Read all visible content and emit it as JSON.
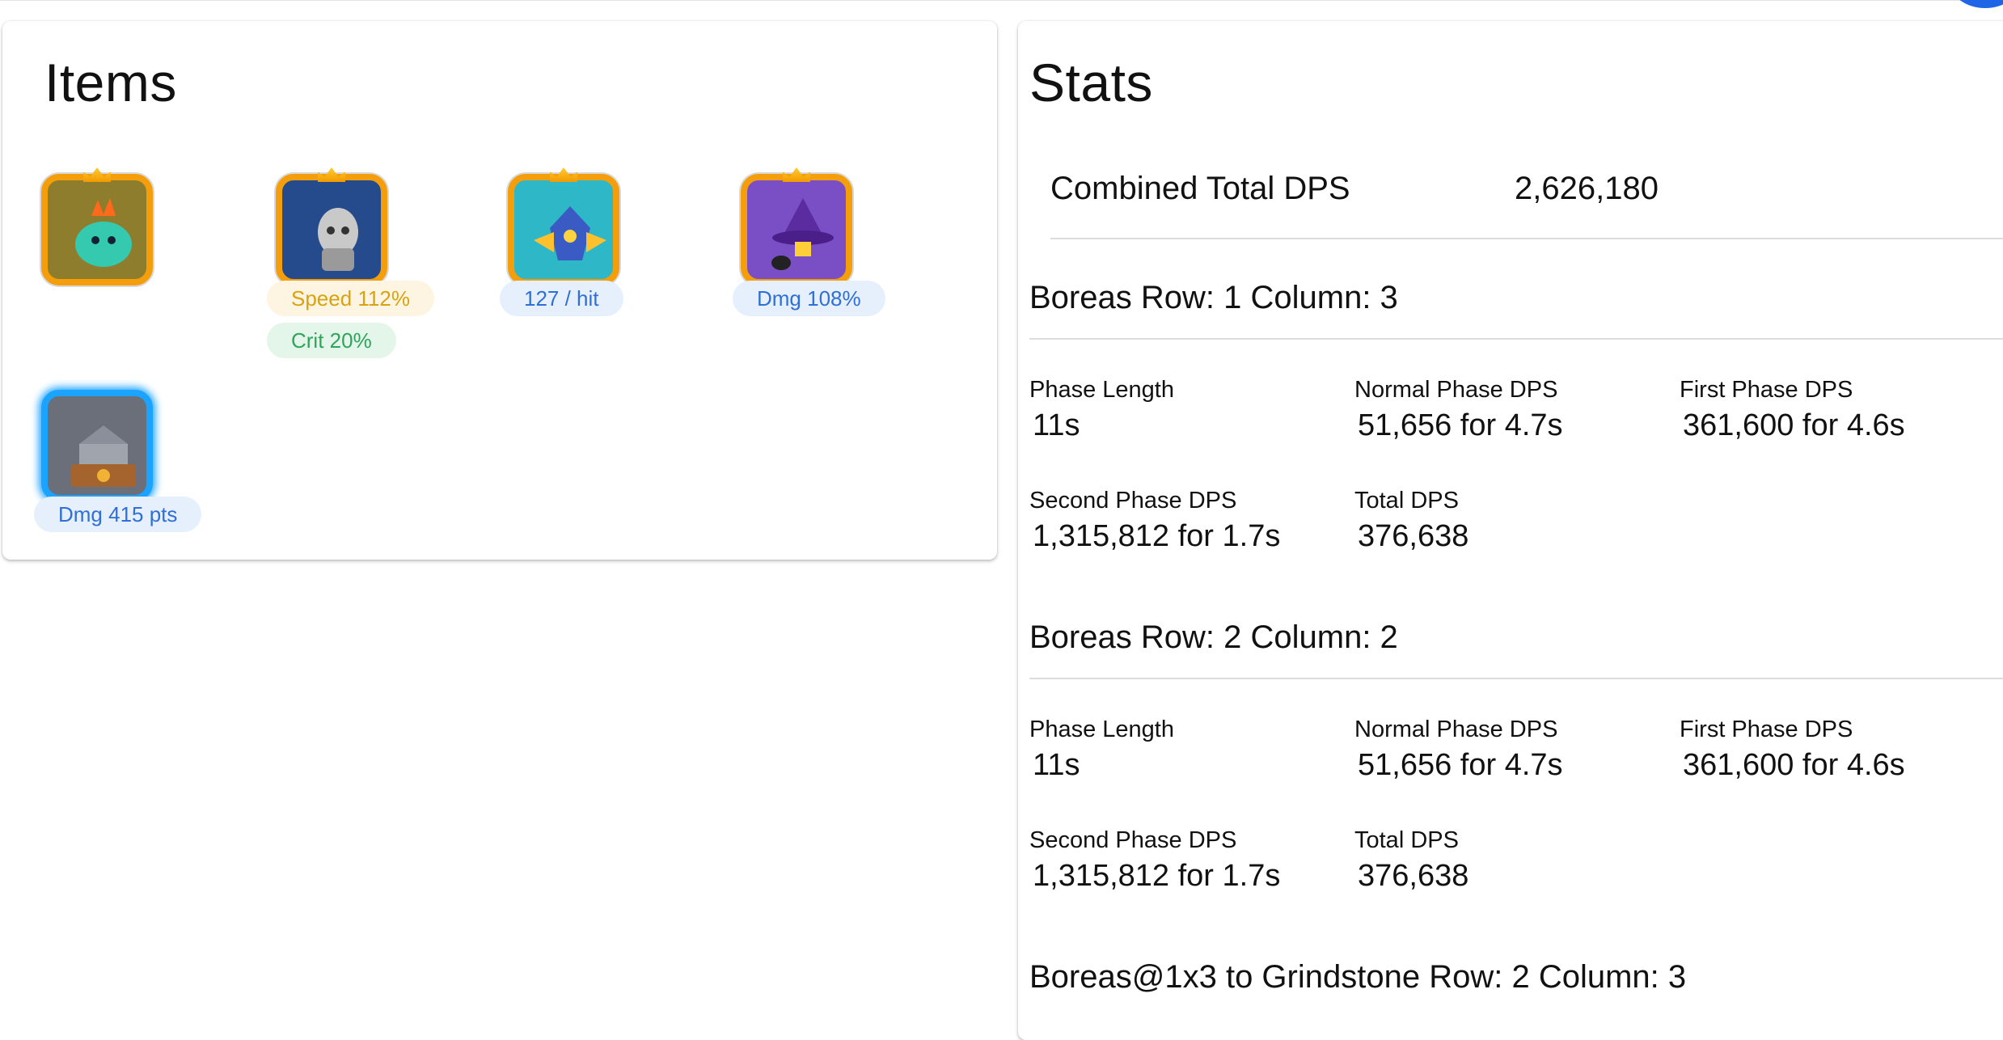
{
  "items_panel": {
    "title": "Items",
    "items": [
      {
        "icon": "dragon-egg-icon",
        "border": "#f59e0b",
        "bg": "#8f7d2e",
        "chips": []
      },
      {
        "icon": "knight-statue-icon",
        "border": "#f59e0b",
        "bg": "#254b8c",
        "chips": [
          {
            "text": "Speed 112%",
            "color": "yellow"
          },
          {
            "text": "Crit 20%",
            "color": "green"
          }
        ]
      },
      {
        "icon": "winged-helmet-icon",
        "border": "#f59e0b",
        "bg": "#2eb8c7",
        "chips": [
          {
            "text": "127 / hit",
            "color": "blue"
          }
        ]
      },
      {
        "icon": "witch-hat-icon",
        "border": "#f59e0b",
        "bg": "#7a4fc5",
        "chips": [
          {
            "text": "Dmg 108%",
            "color": "blue"
          }
        ]
      },
      {
        "icon": "grindstone-icon",
        "border": "#1aa3ff",
        "bg": "#6b6f7a",
        "chips": [
          {
            "text": "Dmg 415 pts",
            "color": "blue"
          }
        ]
      }
    ]
  },
  "stats_panel": {
    "title": "Stats",
    "combined_label": "Combined Total DPS",
    "combined_value": "2,626,180",
    "sections": [
      {
        "name": "Boreas",
        "position": "Row: 1 Column: 3",
        "metrics": [
          {
            "label": "Phase Length",
            "value": "11s"
          },
          {
            "label": "Normal Phase DPS",
            "value": "51,656 for 4.7s"
          },
          {
            "label": "First Phase DPS",
            "value": "361,600 for 4.6s"
          },
          {
            "label": "Second Phase DPS",
            "value": "1,315,812 for 1.7s"
          },
          {
            "label": "Total DPS",
            "value": "376,638"
          }
        ]
      },
      {
        "name": "Boreas",
        "position": "Row: 2 Column: 2",
        "metrics": [
          {
            "label": "Phase Length",
            "value": "11s"
          },
          {
            "label": "Normal Phase DPS",
            "value": "51,656 for 4.7s"
          },
          {
            "label": "First Phase DPS",
            "value": "361,600 for 4.6s"
          },
          {
            "label": "Second Phase DPS",
            "value": "1,315,812 for 1.7s"
          },
          {
            "label": "Total DPS",
            "value": "376,638"
          }
        ]
      },
      {
        "name": "Boreas@1x3 to Grindstone",
        "position": "Row: 2 Column: 3",
        "metrics": []
      }
    ]
  }
}
